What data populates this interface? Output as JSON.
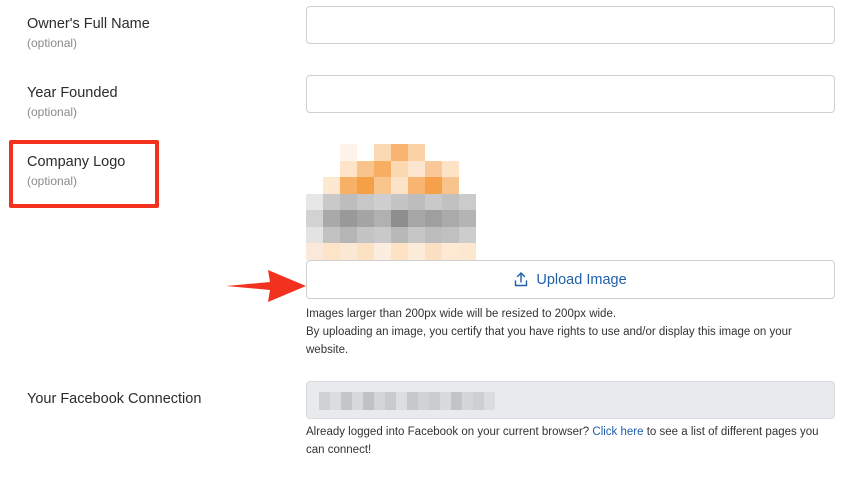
{
  "fields": {
    "owner": {
      "label": "Owner's Full Name",
      "sub": "(optional)",
      "value": ""
    },
    "year": {
      "label": "Year Founded",
      "sub": "(optional)",
      "value": ""
    },
    "logo": {
      "label": "Company Logo",
      "sub": "(optional)"
    },
    "facebook": {
      "label": "Your Facebook Connection"
    }
  },
  "upload": {
    "label": "Upload Image",
    "help_line1": "Images larger than 200px wide will be resized to 200px wide.",
    "help_line2": "By uploading an image, you certify that you have rights to use and/or display this image on your website."
  },
  "facebook_help": {
    "before": "Already logged into Facebook on your current browser?",
    "link": "Click here",
    "after": "to see a list of different pages you can connect!"
  },
  "colors": {
    "highlight": "#f2311e",
    "link": "#1f5fa8",
    "arrow": "#f2311e"
  }
}
